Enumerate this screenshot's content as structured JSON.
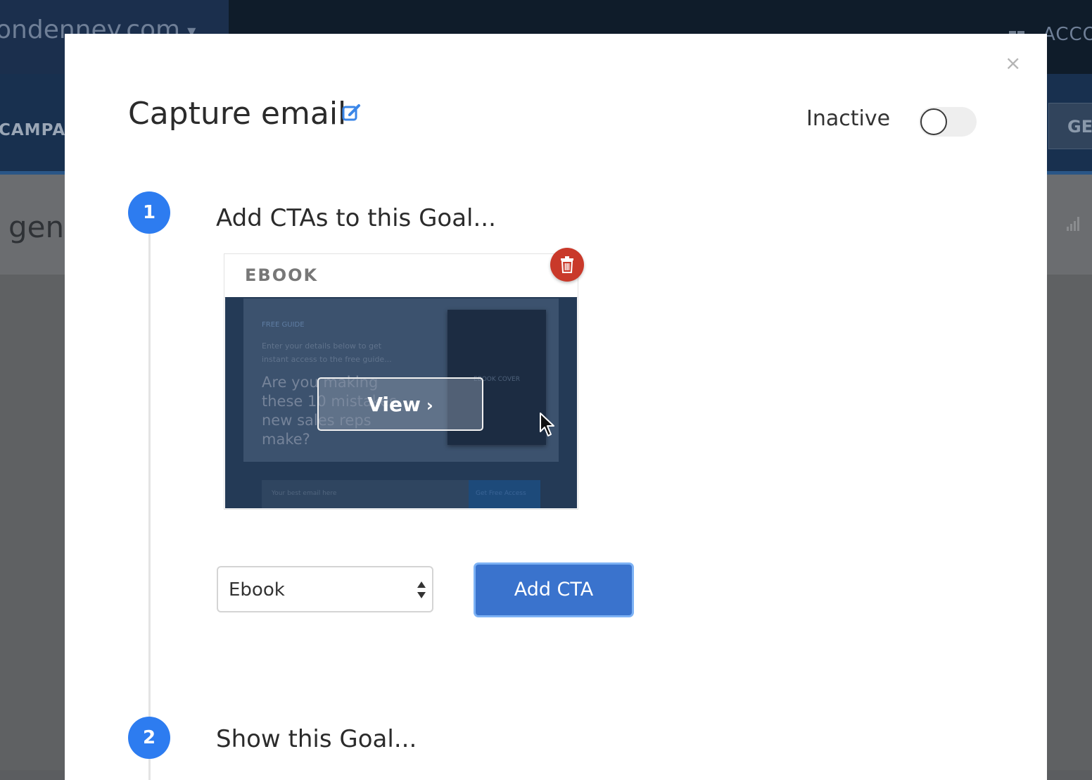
{
  "background": {
    "domain": "ondenney.com",
    "nav_item": "CAMPAIGNS",
    "account_label": "ACCOUNT",
    "right_button": "GET",
    "page_heading": "gen"
  },
  "modal": {
    "title": "Capture email",
    "status_label": "Inactive",
    "toggle_on": false,
    "close_label": "×"
  },
  "steps": [
    {
      "number": "1",
      "title": "Add CTAs to this Goal..."
    },
    {
      "number": "2",
      "title": "Show this Goal..."
    }
  ],
  "cta_card": {
    "type_label": "EBOOK",
    "view_label": "View",
    "preview": {
      "kicker": "FREE GUIDE",
      "subtext": "Enter your details below to get instant access to the free guide...",
      "headline": "Are you making these 10 mistakes new sales reps make?",
      "cover_label": "EBOOK COVER",
      "input_placeholder": "Your best email here",
      "submit_label": "Get Free Access"
    }
  },
  "cta_select": {
    "value": "Ebook"
  },
  "add_cta_label": "Add CTA",
  "colors": {
    "accent": "#2d7cf0",
    "button": "#3a73cd",
    "delete": "#c9392a"
  }
}
